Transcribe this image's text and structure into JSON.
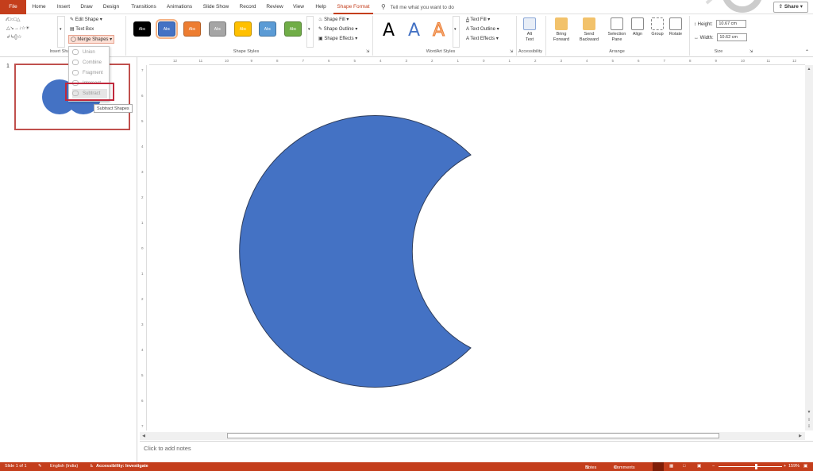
{
  "tabs": [
    "File",
    "Home",
    "Insert",
    "Draw",
    "Design",
    "Transitions",
    "Animations",
    "Slide Show",
    "Record",
    "Review",
    "View",
    "Help",
    "Shape Format"
  ],
  "tell_me": "Tell me what you want to do",
  "share_label": "Share",
  "insert_shapes": {
    "edit_shape": "Edit Shape",
    "text_box": "Text Box",
    "merge_shapes": "Merge Shapes",
    "group_label": "Insert Sha"
  },
  "shape_styles": {
    "chip_label": "Abc",
    "chips": [
      {
        "color": "#000000"
      },
      {
        "color": "#4472c4"
      },
      {
        "color": "#ed7d31"
      },
      {
        "color": "#a5a5a5"
      },
      {
        "color": "#ffc000"
      },
      {
        "color": "#5b9bd5"
      },
      {
        "color": "#70ad47"
      }
    ],
    "fill": "Shape Fill",
    "outline": "Shape Outline",
    "effects": "Shape Effects",
    "group_label": "Shape Styles"
  },
  "wordart": {
    "letter": "A",
    "text_fill": "Text Fill",
    "text_outline": "Text Outline",
    "text_effects": "Text Effects",
    "group_label": "WordArt Styles"
  },
  "accessibility": {
    "alt_text_1": "Alt",
    "alt_text_2": "Text",
    "group_label": "Accessibility"
  },
  "arrange": {
    "bring_1": "Bring",
    "bring_2": "Forward",
    "send_1": "Send",
    "send_2": "Backward",
    "sel_1": "Selection",
    "sel_2": "Pane",
    "align": "Align",
    "group": "Group",
    "rotate": "Rotate",
    "group_label": "Arrange"
  },
  "size": {
    "height_label": "Height:",
    "height_value": "10.67 cm",
    "width_label": "Width:",
    "width_value": "10.62 cm",
    "group_label": "Size"
  },
  "dropdown": {
    "items": [
      "Union",
      "Combine",
      "Fragment",
      "Intersect",
      "Subtract"
    ],
    "tooltip": "Subtract Shapes"
  },
  "slide_number": "1",
  "ruler_h": [
    "12",
    "11",
    "10",
    "9",
    "8",
    "7",
    "6",
    "5",
    "4",
    "3",
    "2",
    "1",
    "0",
    "1",
    "2",
    "3",
    "4",
    "5",
    "6",
    "7",
    "8",
    "9",
    "10",
    "11",
    "12"
  ],
  "ruler_v": [
    "7",
    "6",
    "5",
    "4",
    "3",
    "2",
    "1",
    "0",
    "1",
    "2",
    "3",
    "4",
    "5",
    "6",
    "7"
  ],
  "notes_placeholder": "Click to add notes",
  "status": {
    "slide": "Slide 1 of 1",
    "language": "English (India)",
    "accessibility": "Accessibility: Investigate",
    "notes": "Notes",
    "comments": "Comments",
    "zoom": "159%"
  },
  "colors": {
    "accent": "#c43e1c",
    "shape_fill": "#4472c4",
    "highlight": "#c0283c"
  }
}
